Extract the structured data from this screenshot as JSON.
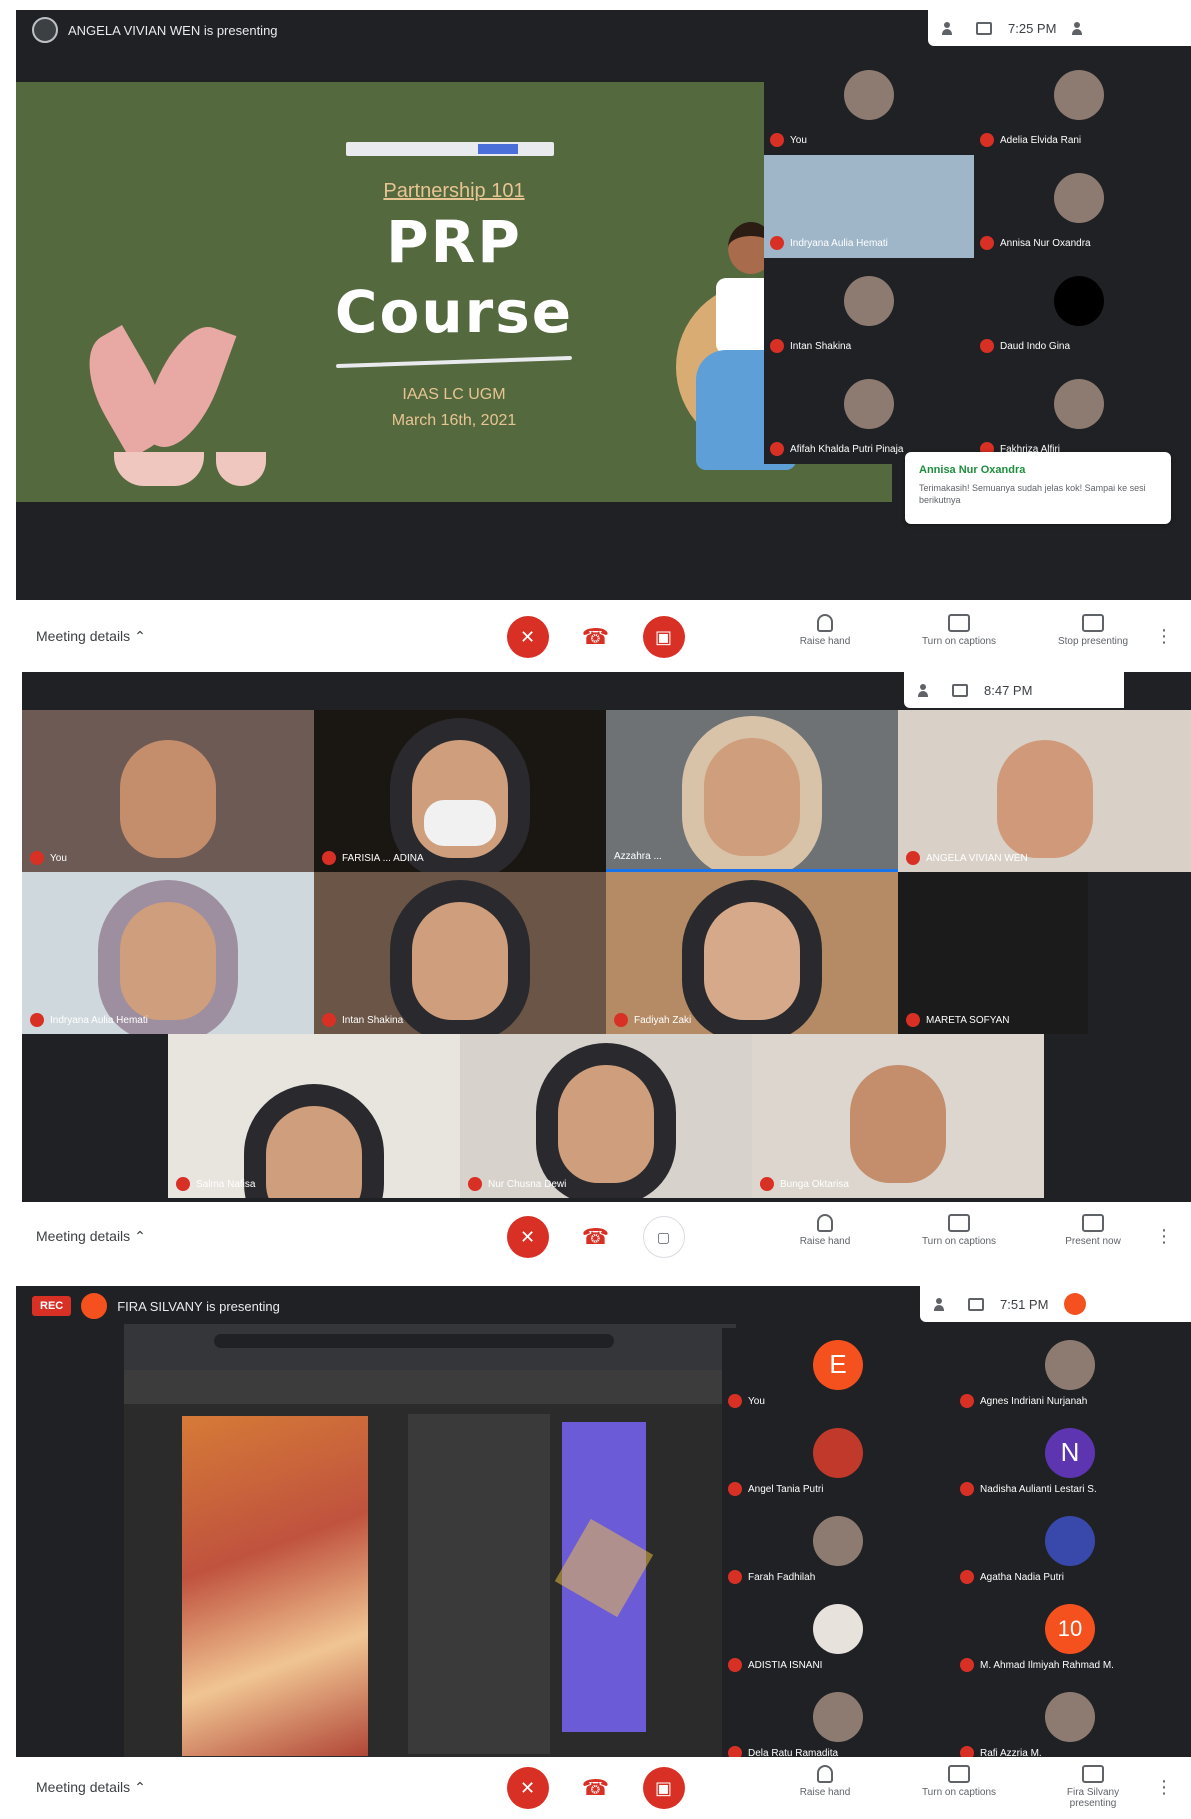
{
  "screenshots": [
    {
      "presenting_label": "ANGELA VIVIAN WEN is presenting",
      "clock": "7:25 PM",
      "slide": {
        "subtitle": "Partnership 101",
        "line1": "PRP",
        "line2": "Course",
        "org_line1": "IAAS LC UGM",
        "org_line2": "March 16th, 2021"
      },
      "participants": [
        {
          "name": "You"
        },
        {
          "name": "Adelia Elvida Rani"
        },
        {
          "name": "Indryana Aulia Hemati"
        },
        {
          "name": "Annisa Nur Oxandra"
        },
        {
          "name": "Intan Shakina"
        },
        {
          "name": "Daud Indo Gina"
        },
        {
          "name": "Afifah Khalda Putri Pinaja"
        },
        {
          "name": "Fakhriza Alfiri"
        }
      ],
      "toast": {
        "title": "Annisa Nur Oxandra",
        "body": "Terimakasih! Semuanya sudah jelas kok! Sampai ke sesi berikutnya"
      },
      "controls": {
        "details": "Meeting details",
        "raise_hand": "Raise hand",
        "captions": "Turn on captions",
        "present": "Stop presenting"
      }
    },
    {
      "clock": "8:47 PM",
      "participants": [
        {
          "name": "You"
        },
        {
          "name": "FARISIA ... ADINA"
        },
        {
          "name": "Azzahra ..."
        },
        {
          "name": "ANGELA VIVIAN WEN"
        },
        {
          "name": "Indryana Aulia Hemati"
        },
        {
          "name": "Intan Shakina"
        },
        {
          "name": "Fadiyah Zaki"
        },
        {
          "name": "MARETA SOFYAN"
        },
        {
          "name": "Salma Nafisa"
        },
        {
          "name": "Nur Chusna Dewi"
        },
        {
          "name": "Bunga Oktarisa"
        }
      ],
      "controls": {
        "details": "Meeting details",
        "raise_hand": "Raise hand",
        "captions": "Turn on captions",
        "present": "Present now"
      }
    },
    {
      "rec": "REC",
      "presenting_label": "FIRA SILVANY is presenting",
      "clock": "7:51 PM",
      "participants": [
        {
          "name": "You",
          "initial": "E",
          "color": "#f4511e"
        },
        {
          "name": "Agnes Indriani Nurjanah",
          "initial": "",
          "color": "#8d7b72"
        },
        {
          "name": "Angel Tania Putri",
          "initial": "",
          "color": "#c0392b"
        },
        {
          "name": "Nadisha Aulianti Lestari S.",
          "initial": "N",
          "color": "#5e35b1"
        },
        {
          "name": "Farah Fadhilah",
          "initial": "",
          "color": "#8d7b72"
        },
        {
          "name": "Agatha Nadia Putri",
          "initial": "",
          "color": "#3949ab"
        },
        {
          "name": "ADISTIA ISNANI",
          "initial": "",
          "color": "#e8e2dc"
        },
        {
          "name": "M. Ahmad Ilmiyah Rahmad M.",
          "initial": "10",
          "color": "#f4511e"
        },
        {
          "name": "Dela Ratu Ramadita",
          "initial": "",
          "color": "#8d7b72"
        },
        {
          "name": "Rafi Azzria M.",
          "initial": "",
          "color": "#8d7b72"
        }
      ],
      "controls": {
        "details": "Meeting details",
        "raise_hand": "Raise hand",
        "captions": "Turn on captions",
        "present": "Fira Silvany presenting"
      }
    }
  ],
  "symbols": {
    "mic_off": "✕",
    "hangup": "☎",
    "cam_off": "▣",
    "cam_on": "▢",
    "more": "⋮",
    "caret": "⌃"
  }
}
